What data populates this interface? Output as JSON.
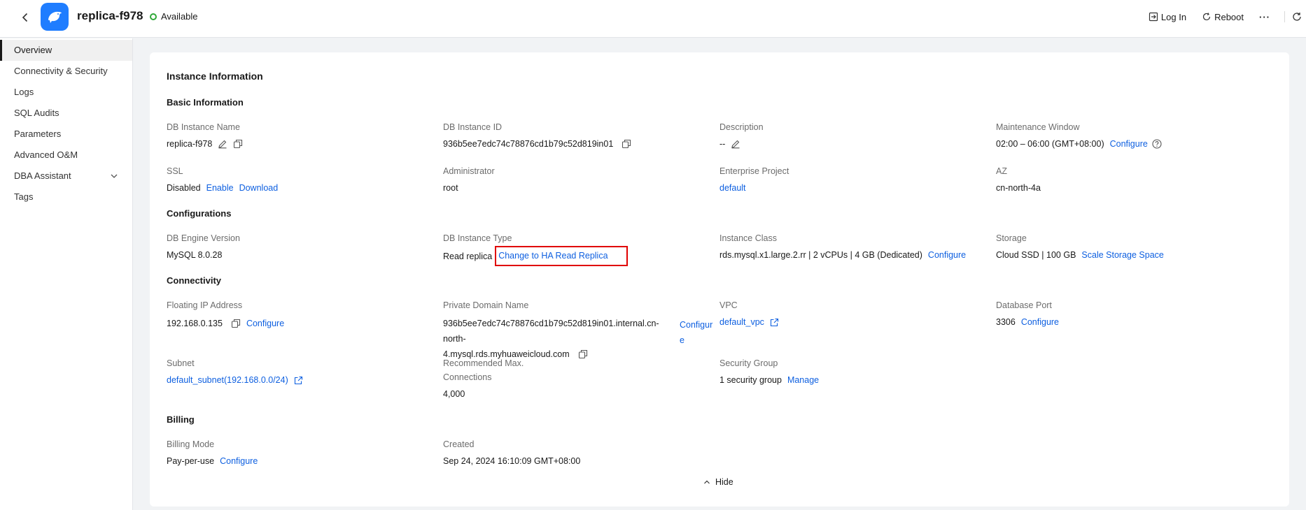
{
  "header": {
    "title": "replica-f978",
    "status": "Available",
    "actions": {
      "login": "Log In",
      "reboot": "Reboot",
      "more": "···"
    }
  },
  "sidebar": {
    "items": [
      {
        "label": "Overview"
      },
      {
        "label": "Connectivity & Security"
      },
      {
        "label": "Logs"
      },
      {
        "label": "SQL Audits"
      },
      {
        "label": "Parameters"
      },
      {
        "label": "Advanced O&M"
      },
      {
        "label": "DBA Assistant"
      },
      {
        "label": "Tags"
      }
    ]
  },
  "card": {
    "title": "Instance Information",
    "hide": "Hide",
    "sections": {
      "basic": "Basic Information",
      "configurations": "Configurations",
      "connectivity": "Connectivity",
      "billing": "Billing"
    },
    "basic": {
      "instance_name": {
        "label": "DB Instance Name",
        "value": "replica-f978"
      },
      "instance_id": {
        "label": "DB Instance ID",
        "value": "936b5ee7edc74c78876cd1b79c52d819in01"
      },
      "description": {
        "label": "Description",
        "value": "--"
      },
      "maintenance": {
        "label": "Maintenance Window",
        "value": "02:00 – 06:00 (GMT+08:00)",
        "link": "Configure"
      },
      "ssl": {
        "label": "SSL",
        "value": "Disabled",
        "enable": "Enable",
        "download": "Download"
      },
      "administrator": {
        "label": "Administrator",
        "value": "root"
      },
      "enterprise_project": {
        "label": "Enterprise Project",
        "value": "default"
      },
      "az": {
        "label": "AZ",
        "value": "cn-north-4a"
      }
    },
    "configurations": {
      "engine_version": {
        "label": "DB Engine Version",
        "value": "MySQL 8.0.28"
      },
      "instance_type": {
        "label": "DB Instance Type",
        "value": "Read replica",
        "link": "Change to HA Read Replica"
      },
      "instance_class": {
        "label": "Instance Class",
        "value": "rds.mysql.x1.large.2.rr | 2 vCPUs | 4 GB (Dedicated)",
        "link": "Configure"
      },
      "storage": {
        "label": "Storage",
        "value": "Cloud SSD | 100 GB",
        "link": "Scale Storage Space"
      }
    },
    "connectivity": {
      "floating_ip": {
        "label": "Floating IP Address",
        "value": "192.168.0.135",
        "link": "Configure"
      },
      "private_domain": {
        "label": "Private Domain Name",
        "value_line1": "936b5ee7edc74c78876cd1b79c52d819in01.internal.cn-north-",
        "value_line2": "4.mysql.rds.myhuaweicloud.com",
        "link_line1": "Configur",
        "link_line2": "e"
      },
      "vpc": {
        "label": "VPC",
        "value": "default_vpc"
      },
      "db_port": {
        "label": "Database Port",
        "value": "3306",
        "link": "Configure"
      },
      "subnet": {
        "label": "Subnet",
        "value": "default_subnet(192.168.0.0/24)"
      },
      "max_connections": {
        "label_line1": "Recommended Max.",
        "label_line2": "Connections",
        "value": "4,000"
      },
      "security_group": {
        "label": "Security Group",
        "value": "1 security group",
        "link": "Manage"
      }
    },
    "billing": {
      "mode": {
        "label": "Billing Mode",
        "value": "Pay-per-use",
        "link": "Configure"
      },
      "created": {
        "label": "Created",
        "value": "Sep 24, 2024 16:10:09 GMT+08:00"
      }
    }
  }
}
